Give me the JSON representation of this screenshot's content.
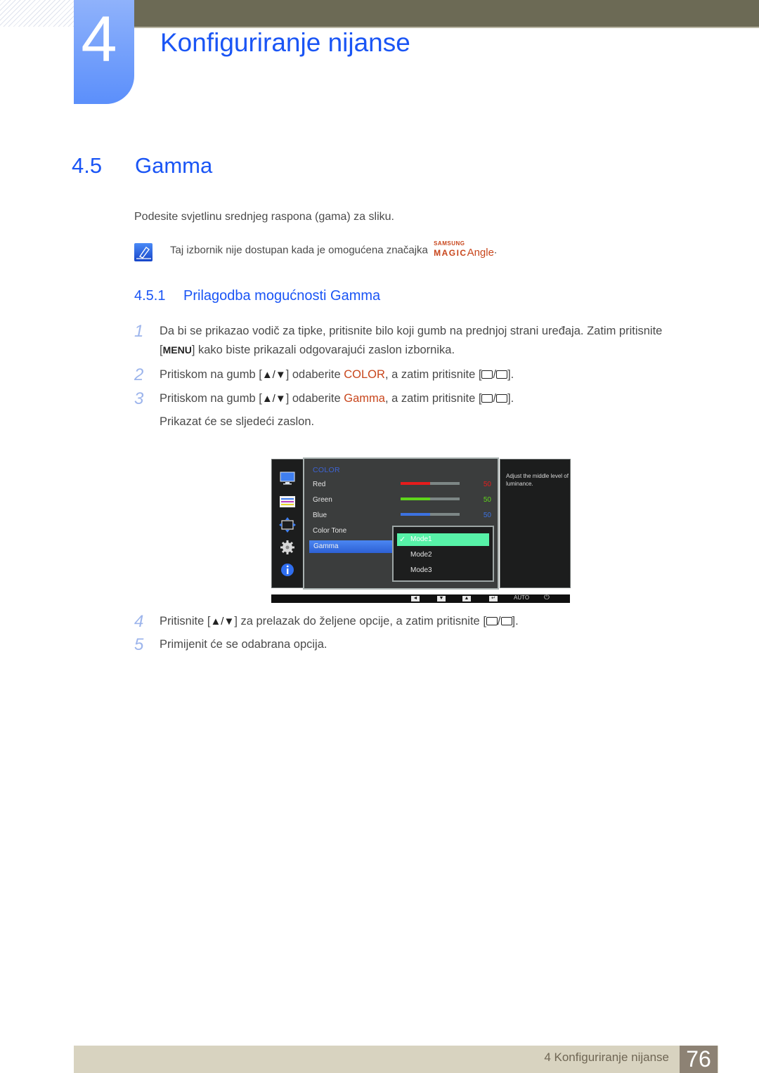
{
  "header": {
    "chapter_number": "4",
    "chapter_title": "Konfiguriranje nijanse"
  },
  "section": {
    "number": "4.5",
    "title": "Gamma",
    "intro": "Podesite svjetlinu srednjeg raspona (gama) za sliku.",
    "note": {
      "icon": "note-pencil-icon",
      "text": "Taj izbornik nije dostupan kada je omogućena značajka",
      "brand_small": "SAMSUNG",
      "brand_magic": "MAGIC",
      "brand_feature": "Angle",
      "suffix": "."
    }
  },
  "subsection": {
    "number": "4.5.1",
    "title": "Prilagodba mogućnosti Gamma"
  },
  "steps": [
    {
      "n": "1",
      "line1": "Da bi se prikazao vodič za tipke, pritisnite bilo koji gumb na prednjoj strani uređaja. Zatim pritisnite",
      "line2_key": "MENU",
      "line2": "kako biste prikazali odgovarajući zaslon izbornika."
    },
    {
      "n": "2",
      "pre": "Pritiskom na gumb [",
      "arrows": "▲/▼",
      "mid": "] odaberite ",
      "highlight": "COLOR",
      "post": ", a zatim pritisnite ["
    },
    {
      "n": "3",
      "pre": "Pritiskom na gumb [",
      "arrows": "▲/▼",
      "mid": "] odaberite ",
      "highlight": "Gamma",
      "post": ", a zatim pritisnite [",
      "after": "Prikazat će se sljedeći zaslon."
    },
    {
      "n": "4",
      "pre": "Pritisnite [",
      "arrows": "▲/▼",
      "mid": "] za prelazak do željene opcije, a zatim pritisnite ["
    },
    {
      "n": "5",
      "text": "Primijenit će se odabrana opcija."
    }
  ],
  "osd": {
    "menu_heading": "COLOR",
    "side_icons": [
      "monitor-icon",
      "color-settings-icon",
      "size-position-icon",
      "gear-icon",
      "info-icon"
    ],
    "items": [
      {
        "label": "Red",
        "value": "50",
        "fraction": 0.5,
        "color": "#e61c1c"
      },
      {
        "label": "Green",
        "value": "50",
        "fraction": 0.5,
        "color": "#5fd61c"
      },
      {
        "label": "Blue",
        "value": "50",
        "fraction": 0.5,
        "color": "#3c72e0"
      },
      {
        "label": "Color Tone"
      },
      {
        "label": "Gamma",
        "selected": true
      }
    ],
    "gamma_options": [
      {
        "label": "Mode1",
        "selected": true
      },
      {
        "label": "Mode2"
      },
      {
        "label": "Mode3"
      }
    ],
    "hint": "Adjust the middle level of luminance.",
    "buttons": {
      "left": "◄",
      "down": "▼",
      "up": "▲",
      "enter": "↵",
      "auto": "AUTO",
      "power": "⏻"
    }
  },
  "footer": {
    "text": "4 Konfiguriranje nijanse",
    "page": "76"
  }
}
